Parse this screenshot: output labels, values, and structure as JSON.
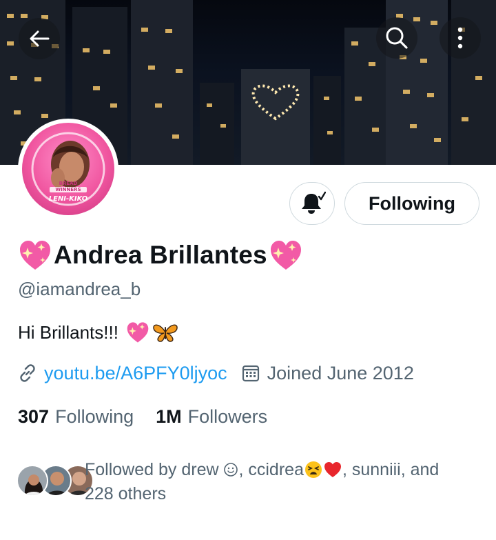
{
  "header": {
    "back_icon": "arrow-left-icon",
    "search_icon": "search-icon",
    "more_icon": "more-vertical-icon"
  },
  "avatar": {
    "text_line1": "BREAD",
    "text_line2": "WINNERS",
    "text_line3": "LENI-KIKO"
  },
  "actions": {
    "notify_icon": "bell-check-icon",
    "following_label": "Following"
  },
  "profile": {
    "display_name": "Andrea Brillantes",
    "handle": "@iamandrea_b",
    "bio": "Hi Brillants!!!",
    "link_text": "youtu.be/A6PFY0ljyoc",
    "joined": "Joined June 2012",
    "following_count": "307",
    "following_label": "Following",
    "followers_count": "1M",
    "followers_label": "Followers"
  },
  "followed_by": {
    "prefix": "Followed by drew ",
    "part2": ", ccidrea",
    "part3": ", sunniii, and",
    "line2": "228 others"
  },
  "colors": {
    "accent_link": "#1d9bf0",
    "muted_text": "#536471",
    "border": "#cfd9de"
  }
}
